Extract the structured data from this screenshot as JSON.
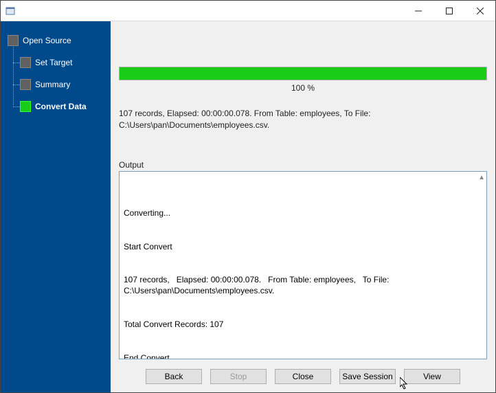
{
  "titlebar": {
    "title": ""
  },
  "sidebar": {
    "items": [
      {
        "label": "Open Source",
        "active": false
      },
      {
        "label": "Set Target",
        "active": false
      },
      {
        "label": "Summary",
        "active": false
      },
      {
        "label": "Convert Data",
        "active": true
      }
    ]
  },
  "progress": {
    "percent": 100,
    "percent_label": "100 %",
    "bar_color": "#18cc18"
  },
  "status_line": "107 records,   Elapsed: 00:00:00.078.   From Table: employees,   To File: C:\\Users\\pan\\Documents\\employees.csv.",
  "output": {
    "label": "Output",
    "lines": [
      "Converting...",
      "Start Convert",
      "107 records,   Elapsed: 00:00:00.078.   From Table: employees,   To File: C:\\Users\\pan\\Documents\\employees.csv.",
      "Total Convert Records: 107",
      "End Convert"
    ]
  },
  "buttons": {
    "back": "Back",
    "stop": "Stop",
    "close": "Close",
    "save_session": "Save Session",
    "view": "View"
  }
}
